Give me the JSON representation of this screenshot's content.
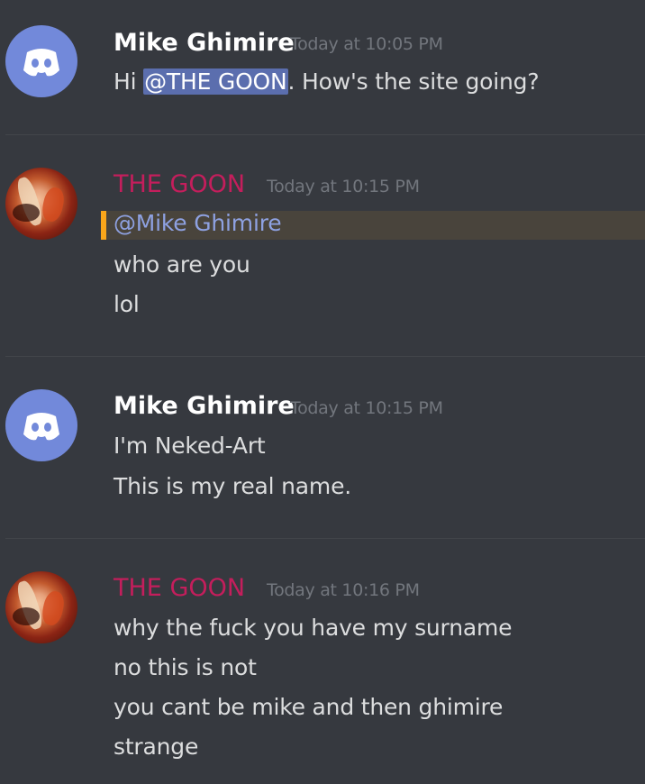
{
  "messages": [
    {
      "author": "Mike Ghimire",
      "timestamp": "Today at 10:05 PM",
      "avatar": "discord-logo-icon",
      "lines": [
        {
          "prefix": "Hi ",
          "mention": "@THE GOON",
          "suffix": ". How's the site going?"
        }
      ]
    },
    {
      "author": "THE GOON",
      "timestamp": "Today at 10:15 PM",
      "avatar": "user-photo",
      "mention_line": "@Mike Ghimire",
      "lines": [
        "who are you",
        "lol"
      ]
    },
    {
      "author": "Mike Ghimire",
      "timestamp": "Today at 10:15 PM",
      "avatar": "discord-logo-icon",
      "lines": [
        "I'm Neked-Art",
        "This is my real name."
      ]
    },
    {
      "author": "THE GOON",
      "timestamp": "Today at 10:16 PM",
      "avatar": "user-photo",
      "lines": [
        "why the fuck you have my surname",
        "no this is not",
        "you cant be mike and then ghimire",
        "strange"
      ]
    }
  ],
  "colors": {
    "background": "#36393f",
    "mention_highlight": "#5b6eae",
    "mentioned_row": "#49443c",
    "mention_bar": "#faa61a",
    "goon_name": "#c41e5c",
    "blurple": "#7289da"
  }
}
